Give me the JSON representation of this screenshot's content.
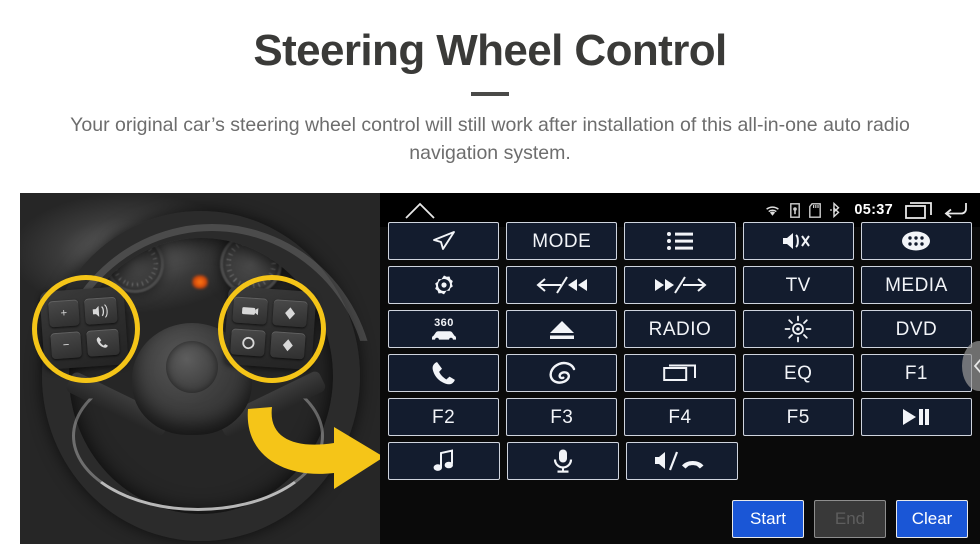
{
  "header": {
    "title": "Steering Wheel Control",
    "subtitle": "Your original car’s steering wheel control will still work after installation of this all-in-one auto radio navigation system."
  },
  "photo": {
    "alt_label": "steering-wheel-photo",
    "highlight_color": "#f5c518",
    "arrow_color": "#f5c518",
    "left_keys": [
      "+",
      "−",
      "voice",
      "call"
    ],
    "right_keys": [
      "display",
      "up",
      "mode",
      "down"
    ]
  },
  "head_unit": {
    "status_bar": {
      "home": "home-icon",
      "icons": [
        "wifi-icon",
        "usb-lock-icon",
        "sd-card-icon",
        "bluetooth-icon"
      ],
      "time": "05:37",
      "recents": "recent-apps-icon",
      "back": "back-icon"
    },
    "scroll_handle": "‹",
    "rows": [
      [
        {
          "name": "navigation",
          "type": "icon",
          "label": "navigation-arrow-icon"
        },
        {
          "name": "mode",
          "type": "text",
          "label": "MODE"
        },
        {
          "name": "menu-list",
          "type": "icon",
          "label": "list-icon"
        },
        {
          "name": "mute",
          "type": "icon",
          "label": "mute-icon"
        },
        {
          "name": "apps",
          "type": "icon",
          "label": "apps-grid-icon"
        }
      ],
      [
        {
          "name": "settings",
          "type": "icon",
          "label": "gear-dot-icon"
        },
        {
          "name": "previous",
          "type": "icon",
          "label": "prev-track-icon"
        },
        {
          "name": "next",
          "type": "icon",
          "label": "next-track-icon"
        },
        {
          "name": "tv",
          "type": "text",
          "label": "TV"
        },
        {
          "name": "media",
          "type": "text",
          "label": "MEDIA"
        }
      ],
      [
        {
          "name": "camera-360",
          "type": "icon",
          "label": "360-car-icon"
        },
        {
          "name": "eject",
          "type": "icon",
          "label": "eject-icon"
        },
        {
          "name": "radio",
          "type": "text",
          "label": "RADIO"
        },
        {
          "name": "brightness",
          "type": "icon",
          "label": "brightness-sun-icon"
        },
        {
          "name": "dvd",
          "type": "text",
          "label": "DVD"
        }
      ],
      [
        {
          "name": "phone",
          "type": "icon",
          "label": "phone-icon"
        },
        {
          "name": "elink",
          "type": "icon",
          "label": "swirl-icon"
        },
        {
          "name": "screen",
          "type": "icon",
          "label": "screen-window-icon"
        },
        {
          "name": "eq",
          "type": "text",
          "label": "EQ"
        },
        {
          "name": "f1",
          "type": "text",
          "label": "F1"
        }
      ],
      [
        {
          "name": "f2",
          "type": "text",
          "label": "F2"
        },
        {
          "name": "f3",
          "type": "text",
          "label": "F3"
        },
        {
          "name": "f4",
          "type": "text",
          "label": "F4"
        },
        {
          "name": "f5",
          "type": "text",
          "label": "F5"
        },
        {
          "name": "play-pause",
          "type": "icon",
          "label": "play-pause-icon"
        }
      ],
      [
        {
          "name": "music",
          "type": "icon",
          "label": "music-note-icon"
        },
        {
          "name": "voice",
          "type": "icon",
          "label": "microphone-icon"
        },
        {
          "name": "speaker-hangup",
          "type": "icon",
          "label": "speaker-hangup-icon"
        },
        {
          "name": "empty-1",
          "type": "empty",
          "label": ""
        },
        {
          "name": "empty-2",
          "type": "empty",
          "label": ""
        }
      ]
    ],
    "commands": [
      {
        "name": "start",
        "label": "Start",
        "state": "enabled",
        "color": "#1a56d6"
      },
      {
        "name": "end",
        "label": "End",
        "state": "disabled",
        "color": "#393939"
      },
      {
        "name": "clear",
        "label": "Clear",
        "state": "enabled",
        "color": "#1a56d6"
      }
    ],
    "labels": {
      "badge_360": "360"
    }
  }
}
